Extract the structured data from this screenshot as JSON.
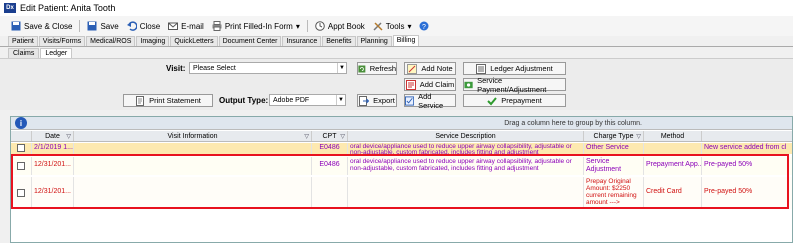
{
  "window": {
    "title": "Edit Patient: Anita Tooth",
    "app_icon": "Dx"
  },
  "toolbar": [
    {
      "icon": "save-icon",
      "label": "Save & Close"
    },
    {
      "icon": "save-icon",
      "label": "Save"
    },
    {
      "icon": "undo-icon",
      "label": "Close"
    },
    {
      "icon": "email-icon",
      "label": "E-mail"
    },
    {
      "icon": "print-icon",
      "label": "Print Filled-In Form"
    },
    {
      "icon": "calendar-icon",
      "label": "Appt Book"
    },
    {
      "icon": "tools-icon",
      "label": "Tools"
    },
    {
      "icon": "help-icon",
      "label": ""
    }
  ],
  "tabs": [
    "Patient",
    "Visits/Forms",
    "Medical/ROS",
    "Imaging",
    "QuickLetters",
    "Document Center",
    "Insurance",
    "Benefits",
    "Planning",
    "Billing"
  ],
  "active_tab": "Billing",
  "subtabs": [
    "Claims",
    "Ledger"
  ],
  "active_subtab": "Ledger",
  "form": {
    "visit_label": "Visit:",
    "visit_value": "Please Select",
    "output_type_label": "Output Type:",
    "output_type_value": "Adobe PDF",
    "buttons": {
      "refresh": "Refresh",
      "add_note": "Add Note",
      "ledger_adjustment": "Ledger Adjustment",
      "add_claim": "Add Claim",
      "service_payment": "Service Payment/Adjustment",
      "print_statement": "Print Statement",
      "export": "Export",
      "add_service": "Add Service",
      "prepayment": "Prepayment"
    }
  },
  "grid": {
    "group_hint": "Drag a column here to group by this column.",
    "columns": [
      "Date",
      "Visit Information",
      "CPT",
      "Service Description",
      "Charge Type",
      "Method",
      ""
    ],
    "rows": [
      {
        "date": "2/1/2019  1...",
        "visit": "",
        "cpt": "E0486",
        "desc": "oral device/appliance used to reduce upper airway collapsibility, adjustable or non-adjustable, custom fabricated, includes fitting and adjustment",
        "charge_type": "Other Service",
        "method": "",
        "note": "New service added from cl"
      },
      {
        "date": "12/31/201...",
        "visit": "",
        "cpt": "E0486",
        "desc": "oral device/appliance used to reduce upper airway collapsibility, adjustable or non-adjustable, custom fabricated, includes fitting and adjustment",
        "charge_type": "Service Adjustment",
        "method": "Prepayment  App...",
        "note": "Pre-payed 50%"
      },
      {
        "date": "12/31/201...",
        "visit": "",
        "cpt": "",
        "desc": "",
        "charge_type": "Prepay Original Amount: $2250 current remaining amount --->",
        "method": "Credit Card",
        "note": "Pre-payed 50%"
      }
    ]
  },
  "colors": {
    "row1_bg": "#fde9b0",
    "purple_text": "#8b00b8",
    "red_text": "#d01010",
    "highlight": "#e8121e"
  }
}
